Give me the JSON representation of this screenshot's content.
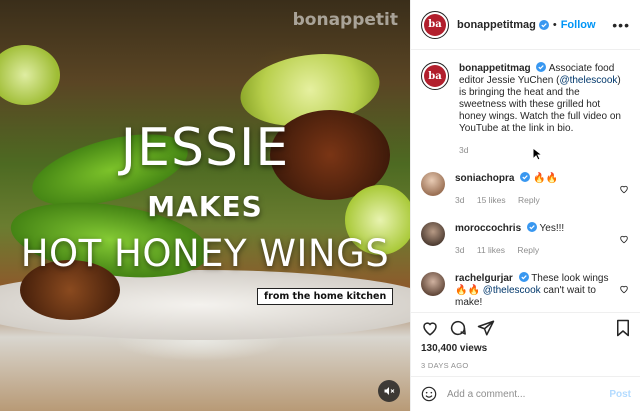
{
  "video": {
    "watermark": "bonappetit",
    "title_line1": "JESSIE",
    "title_line2": "MAKES",
    "title_line3": "HOT HONEY WINGS",
    "tag": "from the home kitchen",
    "mute_icon": "speaker-muted-icon"
  },
  "header": {
    "avatar_text": "ba",
    "username": "bonappetitmag",
    "separator": "•",
    "follow_label": "Follow",
    "more_label": "•••"
  },
  "caption": {
    "username": "bonappetitmag",
    "text_before": "Associate food editor Jessie YuChen (",
    "mention": "@thelescook",
    "text_after": ") is bringing the heat and the sweetness with these grilled hot honey wings. Watch the full video on YouTube at the link in bio.",
    "time": "3d"
  },
  "comments": [
    {
      "username": "soniachopra",
      "text": "🔥🔥",
      "time": "3d",
      "likes": "15 likes",
      "reply": "Reply",
      "avatar_color": "#c9a58a"
    },
    {
      "username": "moroccochris",
      "text": "Yes!!!",
      "time": "3d",
      "likes": "11 likes",
      "reply": "Reply",
      "avatar_color": "#6d5a4a"
    },
    {
      "username": "rachelgurjar",
      "text_before": "These look wings 🔥🔥 ",
      "mention": "@thelescook",
      "text_after": " can't wait to make!",
      "avatar_color": "#8a6d5d"
    }
  ],
  "actions": {
    "views": "130,400 views",
    "date": "3 DAYS AGO"
  },
  "add_comment": {
    "placeholder": "Add a comment...",
    "post_label": "Post"
  },
  "colors": {
    "accent": "#0095f6",
    "verified": "#3897f0",
    "brand_red": "#b21f2d"
  }
}
